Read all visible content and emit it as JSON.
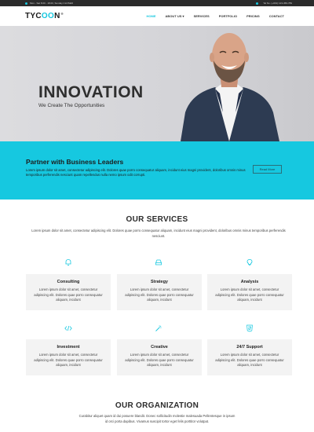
{
  "topbar": {
    "hours": "Mon - Sat 8.00 - 18.00, Sunday CLOSED",
    "phone": "Tel No. (+001) 123-456-789"
  },
  "nav": {
    "logo_main": "TYC",
    "logo_accent": "OO",
    "logo_end": "N",
    "logo_mark": "®",
    "items": [
      {
        "label": "HOME",
        "active": true
      },
      {
        "label": "ABOUT US ▾",
        "active": false
      },
      {
        "label": "SERVICES",
        "active": false
      },
      {
        "label": "PORTFOLIO",
        "active": false
      },
      {
        "label": "PRICING",
        "active": false
      },
      {
        "label": "CONTACT",
        "active": false
      }
    ]
  },
  "hero": {
    "title": "INNOVATION",
    "subtitle": "We Create The Opportunities"
  },
  "partner": {
    "heading": "Partner with Business Leaders",
    "text": "Lorem ipsum dolor sit amet, consectetur adipiscing elit. Dolores quae porro consequatur aliquam, incidunt eius magni provident, doloribus omnis minus temporibus perferendis nesciunt quam repellendus nulla nemo ipsum odit corrupti.",
    "button": "Read More"
  },
  "services": {
    "title": "OUR SERVICES",
    "intro": "Lorem ipsum dolor sit amet, consectetur adipiscing elit. Dolores quae porro consequatur aliquam, incidunt eius magni provident, doloribus omnis minus temporibus perferendis nesciunt.",
    "items": [
      {
        "title": "Consulting",
        "text": "Lorem ipsum dolor sit amet, consectetur adipiscing elit. Dolores quae porro consequatur aliquam, incidunt",
        "icon": "bell-icon"
      },
      {
        "title": "Strategy",
        "text": "Lorem ipsum dolor sit amet, consectetur adipiscing elit. Dolores quae porro consequatur aliquam, incidunt",
        "icon": "hdd-icon"
      },
      {
        "title": "Analysis",
        "text": "Lorem ipsum dolor sit amet, consectetur adipiscing elit. Dolores quae porro consequatur aliquam, incidunt",
        "icon": "lightbulb-icon"
      },
      {
        "title": "Investment",
        "text": "Lorem ipsum dolor sit amet, consectetur adipiscing elit. Dolores quae porro consequatur aliquam, incidunt",
        "icon": "code-icon"
      },
      {
        "title": "Creative",
        "text": "Lorem ipsum dolor sit amet, consectetur adipiscing elit. Dolores quae porro consequatur aliquam, incidunt",
        "icon": "magic-wand-icon"
      },
      {
        "title": "24/7 Support",
        "text": "Lorem ipsum dolor sit amet, consectetur adipiscing elit. Dolores quae porro consequatur aliquam, incidunt",
        "icon": "html5-icon"
      }
    ]
  },
  "organization": {
    "title": "OUR ORGANIZATION",
    "text": "Curabitur aliquet quam id dui posuere blandit. Donec sollicitudin molestie malesuada Pellentesque in ipsum id orci porta dapibus. Vivamus suscipit tortor eget felis porttitor volutpat."
  },
  "colors": {
    "accent": "#16c8e0",
    "dark": "#2b2b2b",
    "card_bg": "#f3f3f3"
  }
}
